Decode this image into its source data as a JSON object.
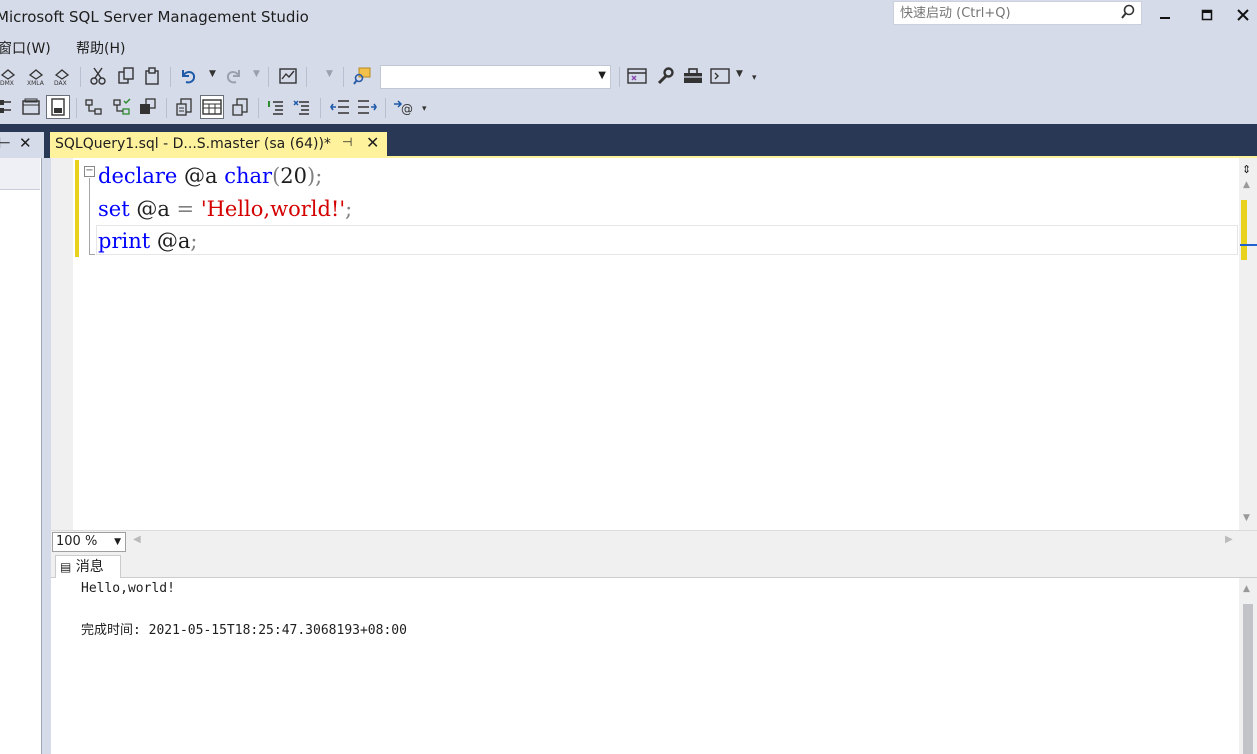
{
  "window": {
    "title": "Microsoft SQL Server Management Studio",
    "quick_launch_placeholder": "快速启动 (Ctrl+Q)"
  },
  "menu": {
    "items": [
      "窗口(W)",
      "帮助(H)"
    ]
  },
  "toolbar1": {
    "icons": [
      "dmx-query-icon",
      "xmla-query-icon",
      "dax-query-icon",
      "cut-icon",
      "copy-icon",
      "paste-icon",
      "undo-icon",
      "redo-icon",
      "activity-monitor-icon",
      "find-icon",
      "database-combo",
      "properties-icon",
      "wrench-icon",
      "toolbox-icon",
      "terminal-icon"
    ],
    "database_value": ""
  },
  "toolbar2": {
    "icons": [
      "results-text-icon",
      "results-grid-icon",
      "results-file-icon",
      "include-plan-icon",
      "client-statistics-icon",
      "io-stats-icon",
      "query-options-icon",
      "results-to-grid-icon",
      "results-to-file-icon",
      "comment-icon",
      "uncomment-icon",
      "outdent-icon",
      "indent-icon",
      "specify-values-icon"
    ]
  },
  "document_tab": {
    "label": "SQLQuery1.sql - D...S.master (sa (64))*",
    "pin_glyph": "⊣",
    "close_glyph": "✕"
  },
  "left_panel": {
    "pin_glyph": "⊢",
    "close_glyph": "✕"
  },
  "editor": {
    "lines": [
      [
        {
          "t": "declare",
          "c": "kw"
        },
        {
          "t": " @a ",
          "c": "id"
        },
        {
          "t": "char",
          "c": "kw"
        },
        {
          "t": "(",
          "c": "punc"
        },
        {
          "t": "20",
          "c": "id"
        },
        {
          "t": ")",
          "c": "punc"
        },
        {
          "t": ";",
          "c": "punc"
        }
      ],
      [
        {
          "t": "set",
          "c": "kw"
        },
        {
          "t": " @a ",
          "c": "id"
        },
        {
          "t": "=",
          "c": "punc"
        },
        {
          "t": " ",
          "c": "id"
        },
        {
          "t": "'Hello,world!'",
          "c": "str"
        },
        {
          "t": ";",
          "c": "punc"
        }
      ],
      [
        {
          "t": "print",
          "c": "kw"
        },
        {
          "t": " @a",
          "c": "id"
        },
        {
          "t": ";",
          "c": "punc"
        }
      ]
    ]
  },
  "zoom": {
    "value": "100 %"
  },
  "results": {
    "tab_label": "消息",
    "output_line": "Hello,world!",
    "completion_line": "完成时间: 2021-05-15T18:25:47.3068193+08:00"
  }
}
